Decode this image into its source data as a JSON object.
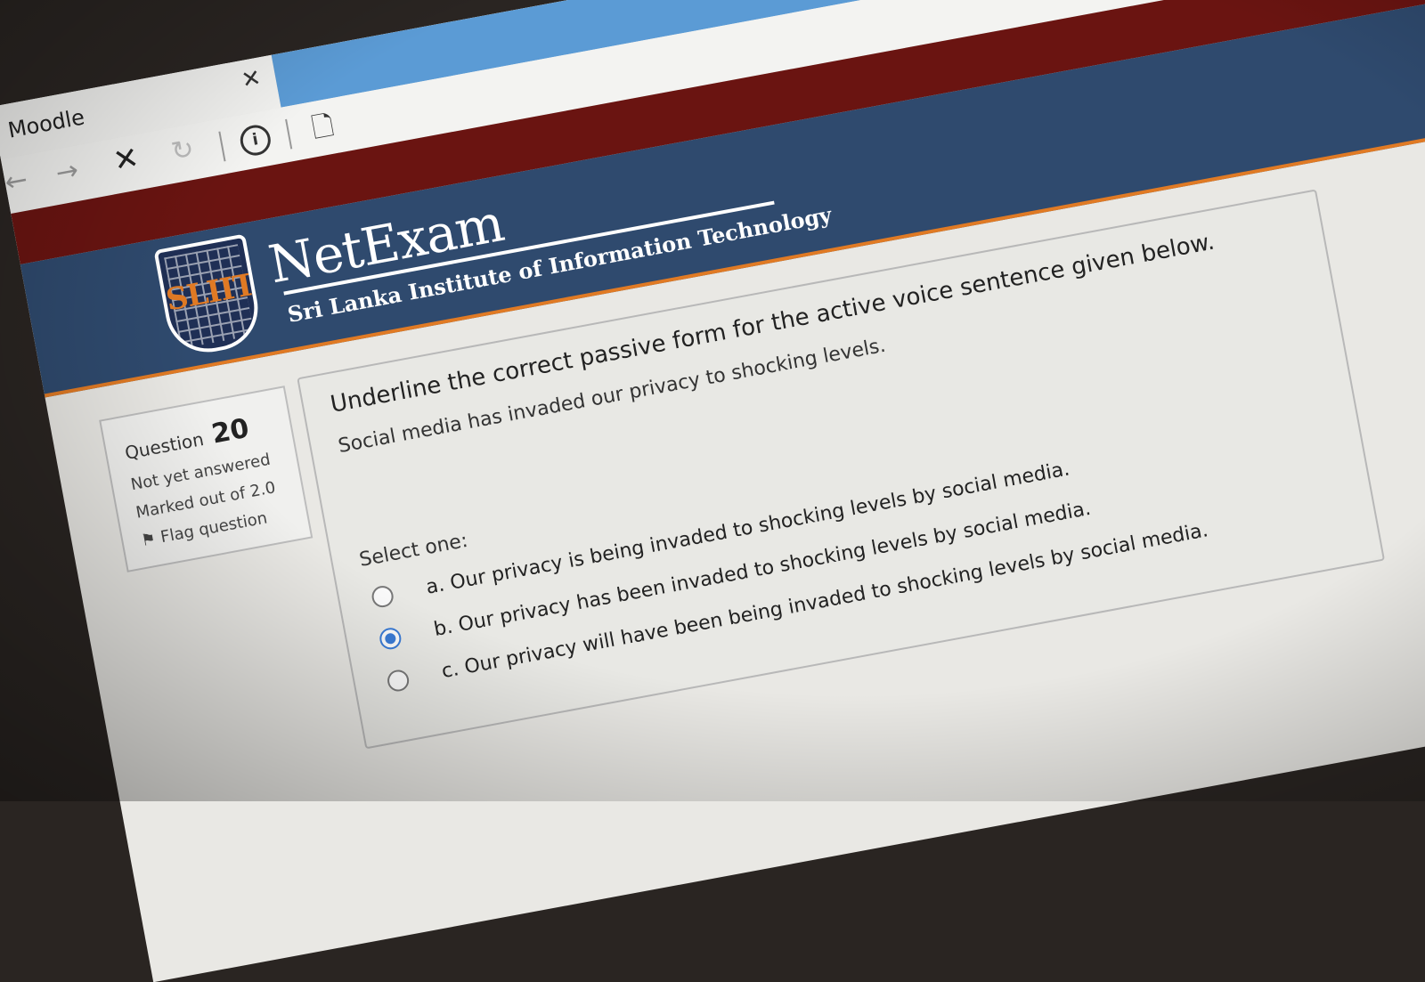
{
  "browser": {
    "tab_title": "Moodle",
    "tab_close_icon": "close-icon",
    "back_icon": "back-arrow-icon",
    "forward_icon": "forward-arrow-icon",
    "stop_icon": "stop-icon",
    "reload_icon": "reload-icon",
    "info_icon": "info-icon",
    "page_icon": "page-action-icon"
  },
  "header": {
    "logo_text": "SLIIT",
    "title": "NetExam",
    "subtitle": "Sri Lanka Institute of Information Technology"
  },
  "question_info": {
    "label": "Question",
    "number": "20",
    "status": "Not yet answered",
    "marks": "Marked out of 2.0",
    "flag_label": "Flag question"
  },
  "question": {
    "prompt": "Underline the correct passive form for the active voice sentence given below.",
    "sentence": "Social media has invaded our privacy to shocking levels.",
    "select_label": "Select one:",
    "options": [
      {
        "label": "a. Our privacy is being invaded to shocking levels by social media.",
        "selected": false
      },
      {
        "label": "b. Our privacy has been invaded to shocking levels by social media.",
        "selected": true
      },
      {
        "label": "c. Our privacy will have been being invaded to shocking levels by social media.",
        "selected": false
      }
    ]
  },
  "colors": {
    "banner": "#2f4a6e",
    "red_band": "#6a1411",
    "accent_orange": "#e07a24",
    "radio_selected": "#3a7bd5"
  }
}
